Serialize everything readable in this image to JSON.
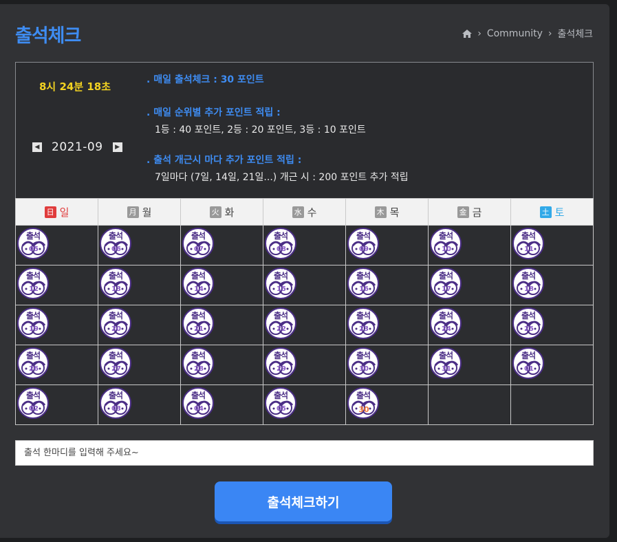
{
  "page": {
    "title": "출석체크"
  },
  "breadcrumb": {
    "community": "Community",
    "current": "출석체크",
    "home_icon": "home-icon"
  },
  "clock": "8시 24분 18초",
  "calendar": {
    "month": "2021-09",
    "prev_icon": "caret-left-icon",
    "next_icon": "caret-right-icon",
    "weekdays": [
      {
        "tag": "日",
        "name": "일"
      },
      {
        "tag": "月",
        "name": "월"
      },
      {
        "tag": "火",
        "name": "화"
      },
      {
        "tag": "水",
        "name": "수"
      },
      {
        "tag": "木",
        "name": "목"
      },
      {
        "tag": "金",
        "name": "금"
      },
      {
        "tag": "土",
        "name": "토"
      }
    ],
    "stamp_text": "출석",
    "weeks": [
      [
        "05",
        "06",
        "07",
        "08",
        "09",
        "10",
        "11"
      ],
      [
        "12",
        "13",
        "14",
        "15",
        "16",
        "17",
        "18"
      ],
      [
        "19",
        "20",
        "21",
        "22",
        "23",
        "24",
        "25"
      ],
      [
        "26",
        "27",
        "28",
        "29",
        "30",
        "31",
        "01"
      ],
      [
        "02",
        "03",
        "04",
        "05",
        "30",
        "",
        ""
      ]
    ],
    "today_label": "30"
  },
  "rules": {
    "daily": ". 매일 출석체크 : 30 포인트",
    "rank_head": ". 매일 순위별 추가 포인트 적립 :",
    "rank_text": "1등 : 40 포인트,  2등 : 20 포인트,  3등 : 10 포인트",
    "streak_head": ". 출석 개근시 마다 추가 포인트 적립 :",
    "streak_text": "7일마다 (7일, 14일, 21일...) 개근 시 : 200 포인트 추가 적립"
  },
  "comment": {
    "placeholder": "출석 한마디를 입력해 주세요~"
  },
  "submit_label": "출석체크하기",
  "colors": {
    "accent": "#3e8cf2",
    "clock": "#f3d321",
    "sunday": "#e03c3c",
    "saturday": "#31a9e8",
    "stamp": "#4b2e86"
  }
}
